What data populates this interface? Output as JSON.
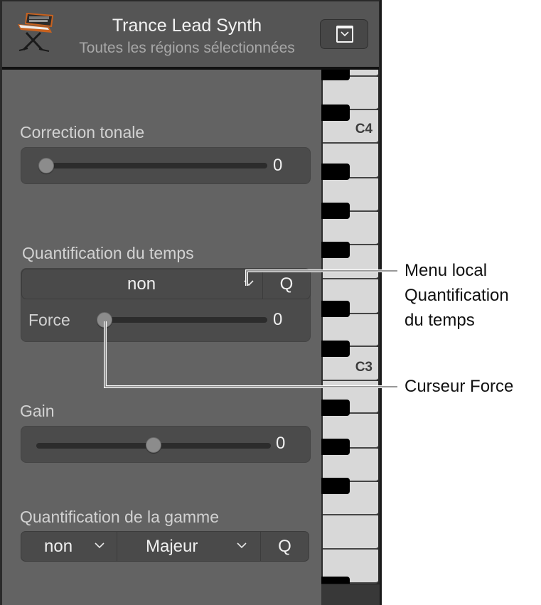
{
  "header": {
    "title": "Trance Lead Synth",
    "subtitle": "Toutes les régions sélectionnées",
    "instrument_icon": "synthesizer-icon",
    "menu_button_icon": "dropdown-menu-icon"
  },
  "pitch_correction": {
    "label": "Correction tonale",
    "value": "0",
    "slider_position": 0.0
  },
  "time_quantize": {
    "label": "Quantification du temps",
    "menu_value": "non",
    "q_button": "Q",
    "strength_label": "Force",
    "strength_value": "0",
    "strength_position": 0.0
  },
  "gain": {
    "label": "Gain",
    "value": "0",
    "slider_position": 0.5
  },
  "scale_quantize": {
    "label": "Quantification de la gamme",
    "root_value": "non",
    "scale_value": "Majeur",
    "q_button": "Q"
  },
  "keyboard": {
    "labels": [
      "C4",
      "C3"
    ]
  },
  "callouts": {
    "menu_line1": "Menu local",
    "menu_line2": "Quantification",
    "menu_line3": "du temps",
    "slider": "Curseur Force"
  }
}
